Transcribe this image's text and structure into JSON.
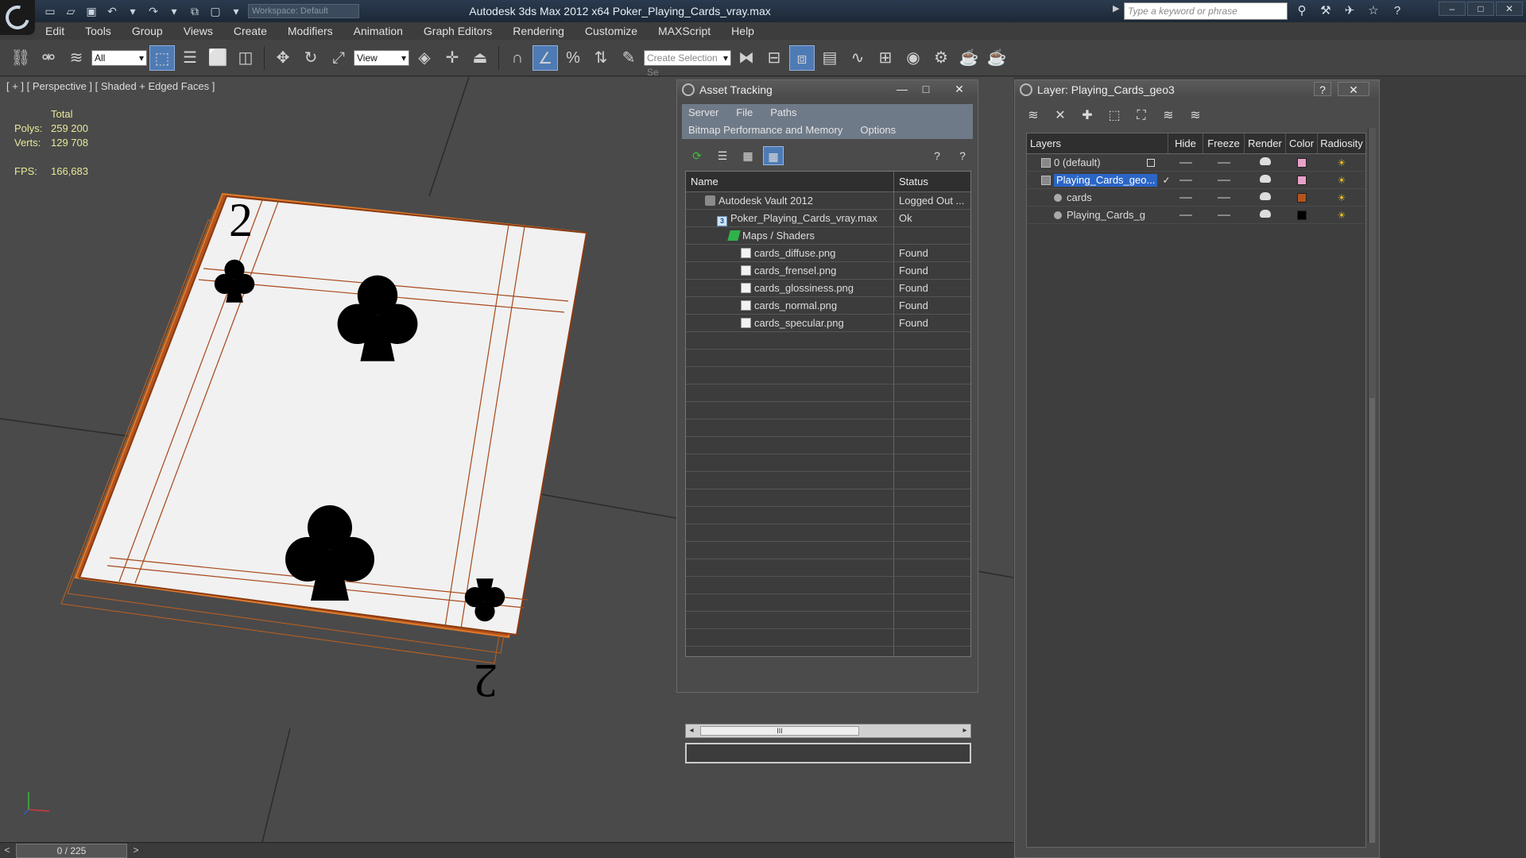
{
  "window": {
    "title": "Autodesk 3ds Max  2012 x64       Poker_Playing_Cards_vray.max",
    "search_placeholder": "Type a keyword or phrase",
    "workspace_value": "Workspace: Default"
  },
  "menu": [
    "Edit",
    "Tools",
    "Group",
    "Views",
    "Create",
    "Modifiers",
    "Animation",
    "Graph Editors",
    "Rendering",
    "Customize",
    "MAXScript",
    "Help"
  ],
  "toolbar": {
    "selection_filter": "All",
    "reference_coord": "View",
    "named_selection_placeholder": "Create Selection Se"
  },
  "viewport": {
    "label": "[ + ] [ Perspective ] [ Shaded + Edged Faces ]",
    "stats": {
      "total_label": "Total",
      "polys_label": "Polys:",
      "polys_value": "259 200",
      "verts_label": "Verts:",
      "verts_value": "129 708",
      "fps_label": "FPS:",
      "fps_value": "166,683"
    },
    "card_rank": "2",
    "colors": {
      "background": "#4a4a4a",
      "wire": "#c05a14",
      "card": "#efefef",
      "pip": "#000000"
    }
  },
  "timeline": {
    "frame": "0 / 225",
    "prev": "<",
    "next": ">"
  },
  "asset_tracking": {
    "title": "Asset Tracking",
    "menus_row1": [
      "Server",
      "File",
      "Paths"
    ],
    "menus_row2": [
      "Bitmap Performance and Memory",
      "Options"
    ],
    "columns": [
      "Name",
      "Status"
    ],
    "rows": [
      {
        "indent": 0,
        "icon": "vault",
        "name": "Autodesk Vault 2012",
        "status": "Logged Out ..."
      },
      {
        "indent": 1,
        "icon": "max",
        "name": "Poker_Playing_Cards_vray.max",
        "status": "Ok"
      },
      {
        "indent": 2,
        "icon": "folder",
        "name": "Maps / Shaders",
        "status": ""
      },
      {
        "indent": 3,
        "icon": "png",
        "name": "cards_diffuse.png",
        "status": "Found"
      },
      {
        "indent": 3,
        "icon": "png",
        "name": "cards_frensel.png",
        "status": "Found"
      },
      {
        "indent": 3,
        "icon": "png",
        "name": "cards_glossiness.png",
        "status": "Found"
      },
      {
        "indent": 3,
        "icon": "png",
        "name": "cards_normal.png",
        "status": "Found"
      },
      {
        "indent": 3,
        "icon": "png",
        "name": "cards_specular.png",
        "status": "Found"
      }
    ],
    "empty_rows": 24,
    "scroll_thumb": "III"
  },
  "layer_manager": {
    "title": "Layer: Playing_Cards_geo3",
    "columns": [
      "Layers",
      "Hide",
      "Freeze",
      "Render",
      "Color",
      "Radiosity"
    ],
    "rows": [
      {
        "name": "0 (default)",
        "kind": "layer",
        "selected": false,
        "current_box": true,
        "color": "#e8a0c8"
      },
      {
        "name": "Playing_Cards_geo...",
        "kind": "layer",
        "selected": true,
        "check": true,
        "color": "#e8a0c8"
      },
      {
        "name": "cards",
        "kind": "object",
        "selected": false,
        "color": "#b5531c"
      },
      {
        "name": "Playing_Cards_g",
        "kind": "object",
        "selected": false,
        "color": "#000000"
      }
    ],
    "check_mark": "✓"
  }
}
